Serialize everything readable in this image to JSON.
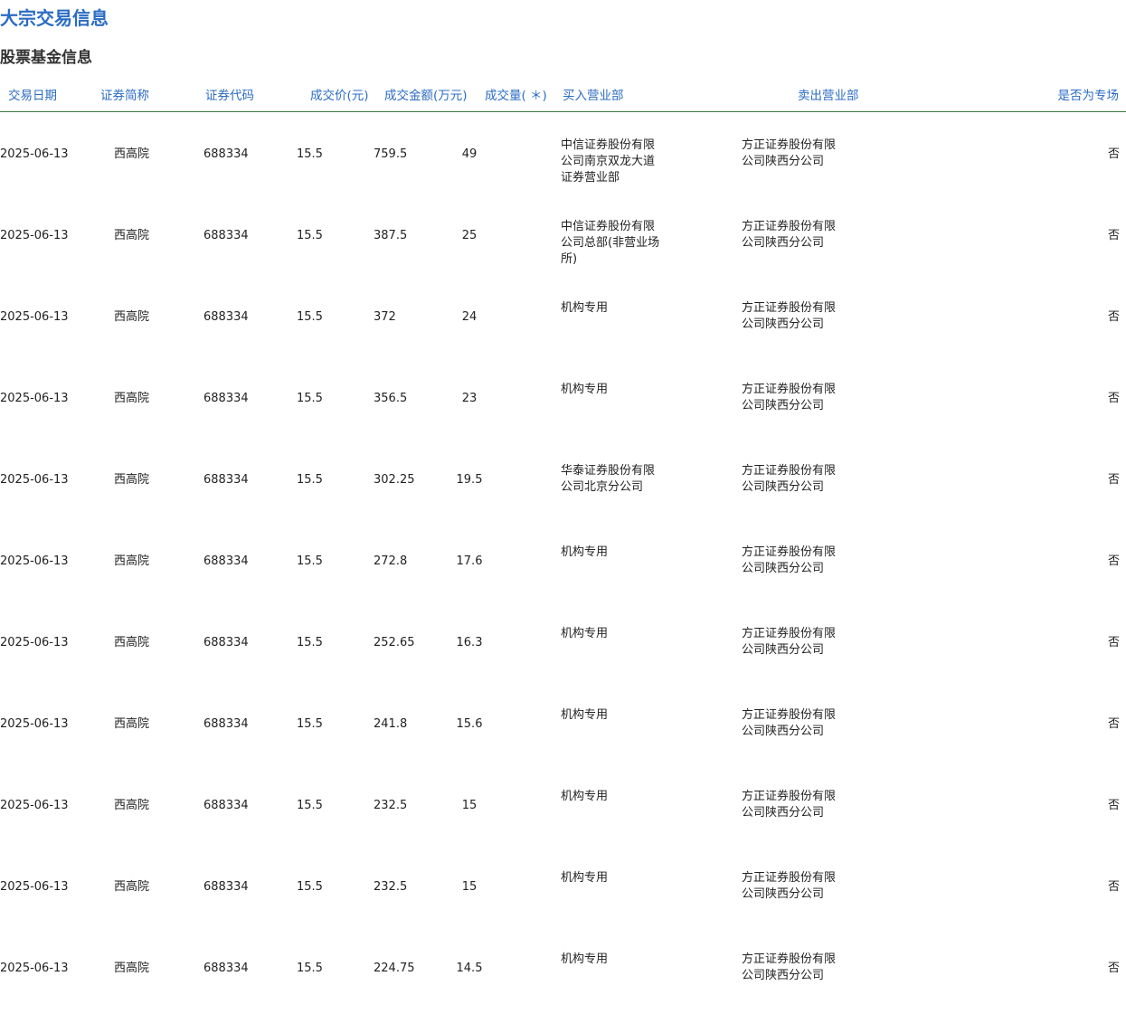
{
  "page_title": "大宗交易信息",
  "section_title": "股票基金信息",
  "columns": {
    "date": "交易日期",
    "name": "证券简称",
    "code": "证券代码",
    "price": "成交价(元)",
    "amount": "成交金额(万元)",
    "volume": "成交量( ＊)",
    "buyer": "买入营业部",
    "seller": "卖出营业部",
    "special": "是否为专场"
  },
  "rows": [
    {
      "date": "2025-06-13",
      "name": "西高院",
      "code": "688334",
      "price": "15.5",
      "amount": "759.5",
      "volume": "49",
      "buyer": "中信证券股份有限公司南京双龙大道证券营业部",
      "seller": "方正证券股份有限公司陕西分公司",
      "special": "否"
    },
    {
      "date": "2025-06-13",
      "name": "西高院",
      "code": "688334",
      "price": "15.5",
      "amount": "387.5",
      "volume": "25",
      "buyer": "中信证券股份有限公司总部(非营业场所)",
      "seller": "方正证券股份有限公司陕西分公司",
      "special": "否"
    },
    {
      "date": "2025-06-13",
      "name": "西高院",
      "code": "688334",
      "price": "15.5",
      "amount": "372",
      "volume": "24",
      "buyer": "机构专用",
      "seller": "方正证券股份有限公司陕西分公司",
      "special": "否"
    },
    {
      "date": "2025-06-13",
      "name": "西高院",
      "code": "688334",
      "price": "15.5",
      "amount": "356.5",
      "volume": "23",
      "buyer": "机构专用",
      "seller": "方正证券股份有限公司陕西分公司",
      "special": "否"
    },
    {
      "date": "2025-06-13",
      "name": "西高院",
      "code": "688334",
      "price": "15.5",
      "amount": "302.25",
      "volume": "19.5",
      "buyer": "华泰证券股份有限公司北京分公司",
      "seller": "方正证券股份有限公司陕西分公司",
      "special": "否"
    },
    {
      "date": "2025-06-13",
      "name": "西高院",
      "code": "688334",
      "price": "15.5",
      "amount": "272.8",
      "volume": "17.6",
      "buyer": "机构专用",
      "seller": "方正证券股份有限公司陕西分公司",
      "special": "否"
    },
    {
      "date": "2025-06-13",
      "name": "西高院",
      "code": "688334",
      "price": "15.5",
      "amount": "252.65",
      "volume": "16.3",
      "buyer": "机构专用",
      "seller": "方正证券股份有限公司陕西分公司",
      "special": "否"
    },
    {
      "date": "2025-06-13",
      "name": "西高院",
      "code": "688334",
      "price": "15.5",
      "amount": "241.8",
      "volume": "15.6",
      "buyer": "机构专用",
      "seller": "方正证券股份有限公司陕西分公司",
      "special": "否"
    },
    {
      "date": "2025-06-13",
      "name": "西高院",
      "code": "688334",
      "price": "15.5",
      "amount": "232.5",
      "volume": "15",
      "buyer": "机构专用",
      "seller": "方正证券股份有限公司陕西分公司",
      "special": "否"
    },
    {
      "date": "2025-06-13",
      "name": "西高院",
      "code": "688334",
      "price": "15.5",
      "amount": "232.5",
      "volume": "15",
      "buyer": "机构专用",
      "seller": "方正证券股份有限公司陕西分公司",
      "special": "否"
    },
    {
      "date": "2025-06-13",
      "name": "西高院",
      "code": "688334",
      "price": "15.5",
      "amount": "224.75",
      "volume": "14.5",
      "buyer": "机构专用",
      "seller": "方正证券股份有限公司陕西分公司",
      "special": "否"
    }
  ]
}
